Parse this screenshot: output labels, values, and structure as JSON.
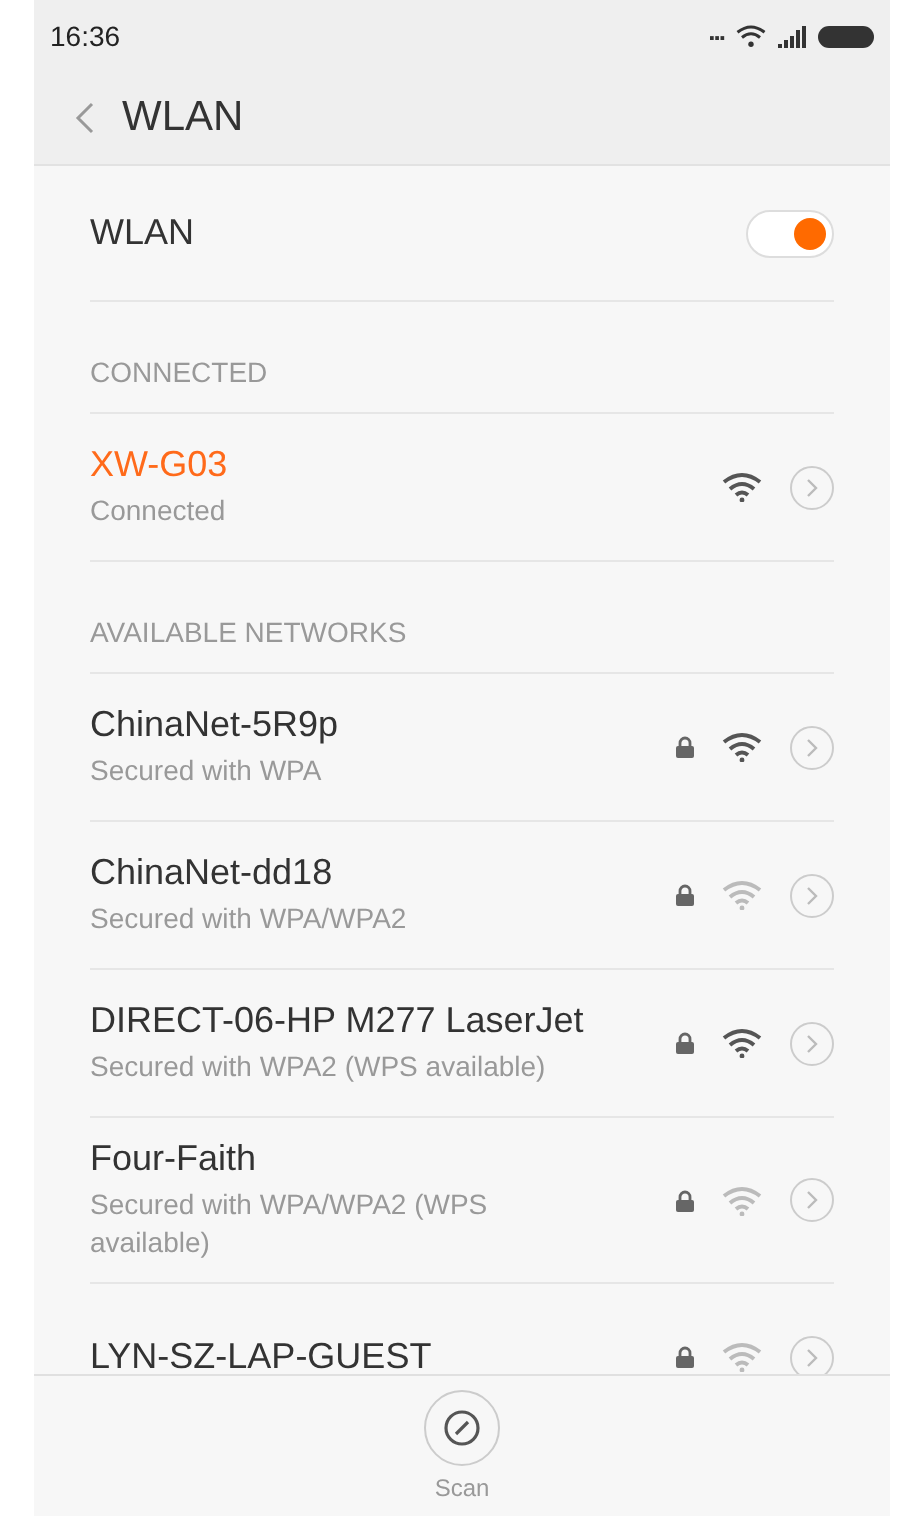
{
  "status_bar": {
    "time": "16:36",
    "more": "..."
  },
  "header": {
    "title": "WLAN"
  },
  "wlan_toggle": {
    "label": "WLAN",
    "on": true
  },
  "connected": {
    "heading": "CONNECTED",
    "networks": [
      {
        "name": "XW-G03",
        "status": "Connected",
        "locked": false,
        "weak_signal": false
      }
    ]
  },
  "available": {
    "heading": "AVAILABLE NETWORKS",
    "networks": [
      {
        "name": "ChinaNet-5R9p",
        "status": "Secured with WPA",
        "locked": true,
        "weak_signal": false
      },
      {
        "name": "ChinaNet-dd18",
        "status": "Secured with WPA/WPA2",
        "locked": true,
        "weak_signal": true
      },
      {
        "name": "DIRECT-06-HP M277 LaserJet",
        "status": "Secured with WPA2 (WPS available)",
        "locked": true,
        "weak_signal": false
      },
      {
        "name": "Four-Faith",
        "status": "Secured with WPA/WPA2 (WPS available)",
        "locked": true,
        "weak_signal": true
      },
      {
        "name": "LYN-SZ-LAP-GUEST",
        "locked": true,
        "weak_signal": true
      }
    ]
  },
  "bottom_bar": {
    "scan_label": "Scan"
  }
}
